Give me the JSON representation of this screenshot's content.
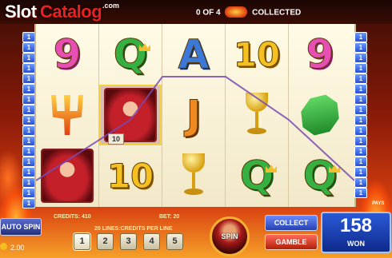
{
  "header": {
    "logo_part1": "Slot",
    "logo_part2": "Catalog",
    "logo_tld": ".com",
    "collected_prefix": "0 OF 4",
    "collected_suffix": "COLLECTED"
  },
  "reels": [
    [
      "9",
      "trident",
      "devil"
    ],
    [
      "Q",
      "devil",
      "10"
    ],
    [
      "A",
      "J",
      "goblet"
    ],
    [
      "10",
      "goblet",
      "Q"
    ],
    [
      "9",
      "emerald",
      "Q"
    ]
  ],
  "win_label": "10",
  "line_markers_left": [
    "1",
    "1",
    "1",
    "1",
    "1",
    "1",
    "1",
    "1",
    "1",
    "1",
    "1",
    "1",
    "1",
    "1",
    "1",
    "1",
    "1"
  ],
  "line_markers_right": [
    "1",
    "1",
    "1",
    "1",
    "1",
    "1",
    "1",
    "1",
    "1",
    "1",
    "1",
    "1",
    "1",
    "1",
    "1",
    "1"
  ],
  "controls": {
    "auto_spin": "AUTO SPIN",
    "coin_value": "2.00",
    "credits_label": "CREDITS: 410",
    "bet_label": "BET: 20",
    "lines_label": "20 LINES:CREDITS PER LINE",
    "credit_buttons": [
      "1",
      "2",
      "3",
      "4",
      "5"
    ],
    "spin": "SPIN",
    "collect": "COLLECT",
    "gamble": "GAMBLE",
    "pays": "PAYS",
    "win_value": "158",
    "win_label": "WON"
  },
  "colors": {
    "nine": "#e84fb2",
    "ten": "#f4c022",
    "queen": "#35b043",
    "ace": "#3b78d8",
    "jack": "#f08a20"
  }
}
